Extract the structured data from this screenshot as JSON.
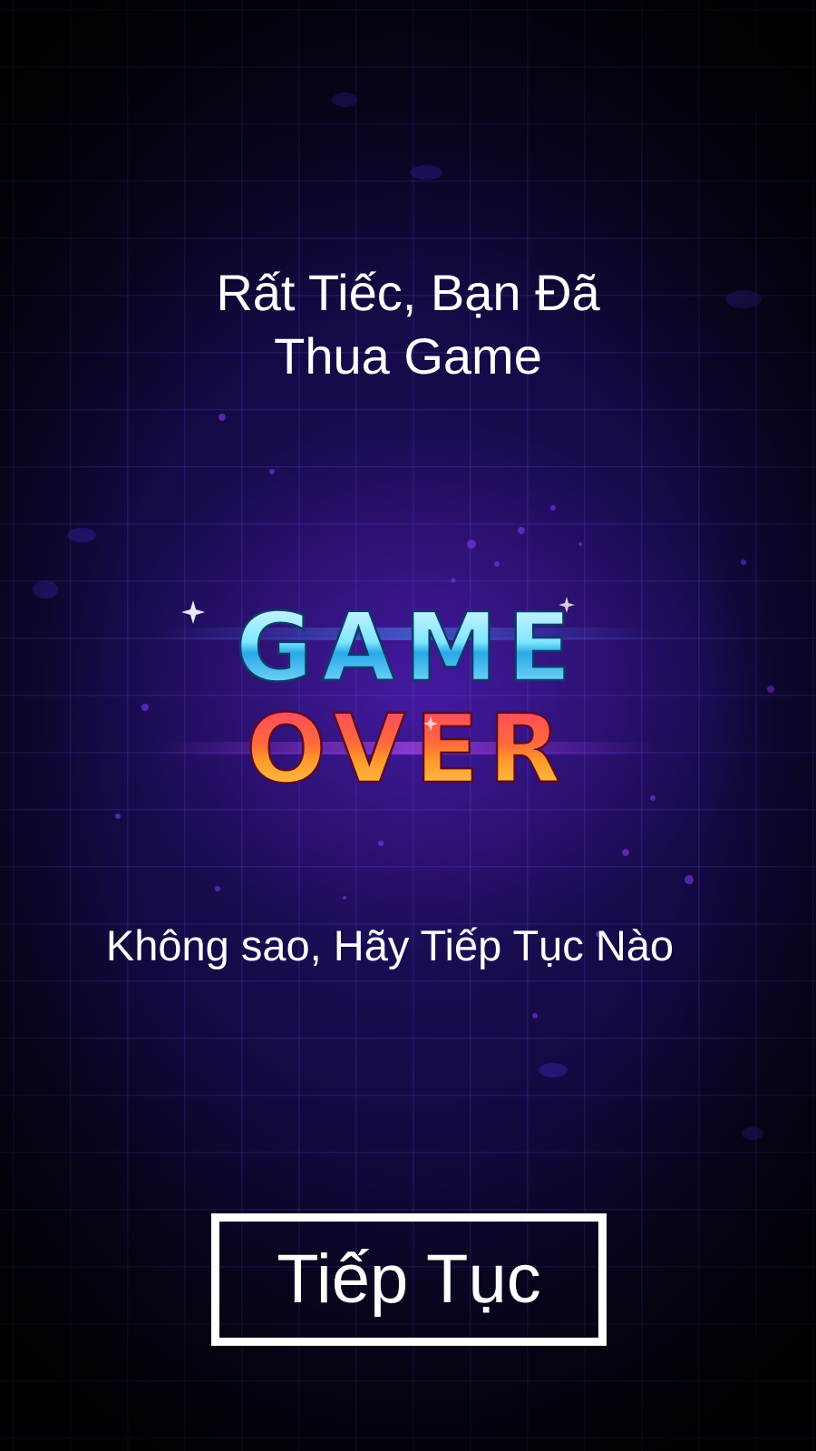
{
  "screen": {
    "title_line1": "Rất Tiếc, Bạn Đã",
    "title_line2": "Thua Game",
    "logo": {
      "line1": "GAME",
      "line2": "OVER",
      "line1_color": "#7fe6ff",
      "line2_color": "#ff8a3a"
    },
    "subtitle": "Không sao, Hãy Tiếp Tục Nào",
    "continue_label": "Tiếp Tục"
  },
  "colors": {
    "background_dark": "#07041a",
    "background_glow": "#241064",
    "grid": "#7860ff",
    "text": "#ffffff"
  }
}
